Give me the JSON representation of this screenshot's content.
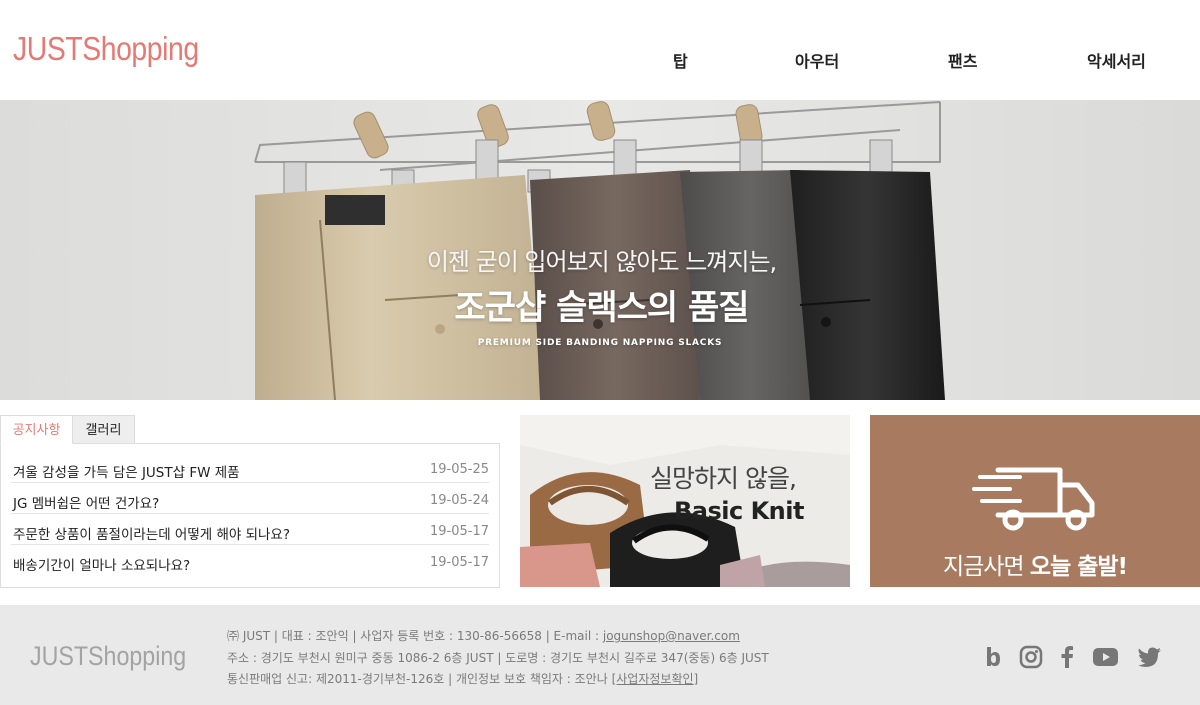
{
  "header": {
    "logo": "JUSTShopping",
    "nav": [
      "탑",
      "아우터",
      "팬츠",
      "악세서리"
    ]
  },
  "banner": {
    "subtitle": "이젠 굳이 입어보지 않아도 느껴지는,",
    "title": "조군샵 슬랙스의 품질",
    "caption": "PREMIUM SIDE BANDING NAPPING SLACKS",
    "colors": {
      "background": "#e3e3e1",
      "pants": [
        "#d2c3a5",
        "#6f625d",
        "#5d5c5a",
        "#2a2a2a"
      ]
    }
  },
  "board": {
    "tabs": [
      "공지사항",
      "갤러리"
    ],
    "active_tab": "공지사항",
    "posts": [
      {
        "title": "겨울 감성을 가득 담은 JUST샵 FW 제품",
        "date": "19-05-25"
      },
      {
        "title": "JG 멤버쉽은 어떤 건가요?",
        "date": "19-05-24"
      },
      {
        "title": "주문한 상품이 품절이라는데 어떻게 해야 되나요?",
        "date": "19-05-17"
      },
      {
        "title": "배송기간이 얼마나 소요되나요?",
        "date": "19-05-17"
      }
    ]
  },
  "promo_knit": {
    "line1": "실망하지 않을,",
    "line2": "Basic Knit"
  },
  "promo_delivery": {
    "text_light": "지금사면 ",
    "text_bold": "오늘 출발!",
    "icon": "delivery-truck-icon",
    "background": "#a87b60"
  },
  "footer": {
    "logo": "JUSTShopping",
    "line1": "㈜ JUST | 대표 : 조안익 | 사업자 등록 번호 : 130-86-56658 | E-mail : ",
    "email": "jogunshop@naver.com",
    "line2": "주소 : 경기도 부천시 원미구 중동 1086-2 6층 JUST | 도로명 : 경기도 부천시 길주로 347(중동) 6층 JUST",
    "line3": "통신판매업 신고: 제2011-경기부천-126호 | 개인정보 보호 책임자 : 조안나 ",
    "biz_link": "[사업자정보확인]",
    "social": [
      "blog-b-icon",
      "instagram-icon",
      "facebook-icon",
      "youtube-icon",
      "twitter-icon"
    ]
  },
  "colors": {
    "accent": "#e57a74",
    "footer_bg": "#e9e9e9",
    "social_icon": "#777777"
  }
}
